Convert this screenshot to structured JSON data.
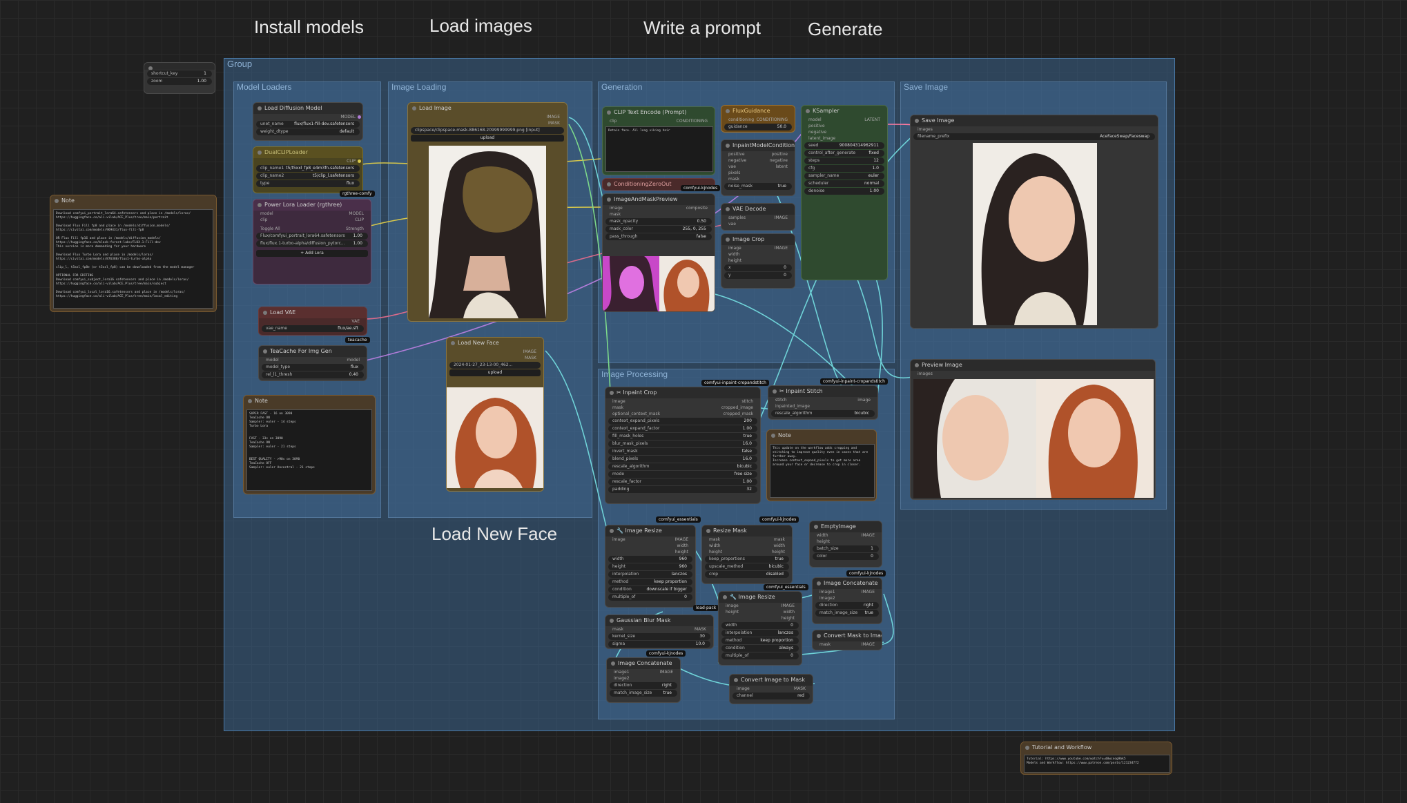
{
  "headings": {
    "install_models": "Install models",
    "load_images": "Load images",
    "write_prompt": "Write a prompt",
    "generate": "Generate",
    "load_new_face": "Load New Face"
  },
  "shortcut": {
    "key_label": "shortcut_key",
    "key_value": "1",
    "zoom_label": "zoom",
    "zoom_value": "1.00"
  },
  "group": {
    "title": "Group"
  },
  "sections": {
    "model_loaders": "Model Loaders",
    "image_loading": "Image Loading",
    "generation": "Generation",
    "save_image": "Save Image",
    "image_processing": "Image Processing"
  },
  "note_left": {
    "title": "Note",
    "text": "Download comfyui_portrait_lora64.safetensors and place in /models/loras/\nhttps://huggingface.co/ali-vilab/ACE_Plus/tree/main/portrait\n\nDownload Flux Fill fp8 and place in /models/diffusion_models/\nhttps://civitai.com/models/969431/flux-fill-fp8\n\nOR Flux Fill fp16 and place in /models/diffusion_models/\nhttps://huggingface.co/black-forest-labs/FLUX.1-Fill-dev\nThis version is more demanding for your hardware\n\nDownload Flux Turbo Lora and place in /models/loras/\nhttps://civitai.com/models/876388/flux1-turbo-alpha\n\nclip_l, t5xxl_fp8e (or t5xxl_fp8) can be downloaded from the model manager\n\nOPTIONAL FOR EDITING\nDownload comfyui_subject_lora16.safetensors and place in /models/loras/\nhttps://huggingface.co/ali-vilab/ACE_Plus/tree/main/subject\n\nDownload comfyui_local_lora16.safetensors and place in /models/loras/\nhttps://huggingface.co/ali-vilab/ACE_Plus/tree/main/local_editing"
  },
  "note_speed": {
    "title": "Note",
    "text": "SUPER FAST - 16 on 3090\nTeaCache ON\nSampler: euler - 14 steps\nTurbo Lora\n\n\nFAST - 33s on 3090\nTeaCache ON\nSampler: euler - 21 steps\n\n\nBEST QUALITY - >90s on 3090\nTeaCache OFF\nSampler: euler Ancestral - 21 steps"
  },
  "nodes": {
    "load_diffusion": {
      "title": "Load Diffusion Model",
      "out": "MODEL",
      "rows": [
        [
          "unet_name",
          "flux/flux1-fill-dev.safetensors"
        ],
        [
          "weight_dtype",
          "default"
        ]
      ]
    },
    "dual_clip": {
      "title": "DualCLIPLoader",
      "out": "CLIP",
      "rows": [
        [
          "clip_name1",
          "t5/t5xxl_fp8_e4m3fn.safetensors"
        ],
        [
          "clip_name2",
          "t5/clip_l.safetensors"
        ],
        [
          "type",
          "flux"
        ]
      ],
      "tag": "rgthree-comfy"
    },
    "power_lora": {
      "title": "Power Lora Loader (rgthree)",
      "in": [
        "model",
        "clip"
      ],
      "out": [
        "MODEL",
        "CLIP"
      ],
      "toggle_label": "Toggle All",
      "strength_label": "Strength",
      "loras": [
        [
          "Flux/comfyui_portrait_lora64.safetensors",
          "1.00"
        ],
        [
          "flux/flux.1-turbo-alpha/diffusion_pytorc...",
          "1.00"
        ]
      ],
      "add": "+ Add Lora"
    },
    "load_vae": {
      "title": "Load VAE",
      "out": "VAE",
      "rows": [
        [
          "vae_name",
          "flux/ae.sft"
        ]
      ],
      "tag": "teacache"
    },
    "teacache": {
      "title": "TeaCache For Img Gen",
      "in": "model",
      "out": "model",
      "rows": [
        [
          "model_type",
          "flux"
        ],
        [
          "rel_l1_thresh",
          "0.40"
        ]
      ]
    },
    "load_image": {
      "title": "Load Image",
      "outs": [
        "IMAGE",
        "MASK"
      ],
      "image": "clipspace/clipspace-mask-886168.20999999999.png [input]",
      "upload": "upload"
    },
    "load_new_face": {
      "title": "Load New Face",
      "outs": [
        "IMAGE",
        "MASK"
      ],
      "image": "2024-01-27_23-13-00_462...",
      "upload": "upload"
    },
    "clip_text": {
      "title": "CLIP Text Encode (Prompt)",
      "in": "clip",
      "out": "CONDITIONING",
      "prompt": "Retain face. All long viking hair"
    },
    "flux_guidance": {
      "title": "FluxGuidance",
      "in": "conditioning",
      "out": "CONDITIONING",
      "rows": [
        [
          "guidance",
          "50.0"
        ]
      ]
    },
    "cond_zero": {
      "title": "ConditioningZeroOut",
      "tag": "comfyui-kjnodes"
    },
    "inpaint_cond": {
      "title": "InpaintModelConditioning",
      "ins": [
        "positive",
        "negative",
        "vae",
        "pixels",
        "mask"
      ],
      "outs": [
        "positive",
        "negative",
        "latent"
      ],
      "rows": [
        [
          "noise_mask",
          "true"
        ]
      ]
    },
    "ksampler": {
      "title": "KSampler",
      "ins": [
        "model",
        "positive",
        "negative",
        "latent_image"
      ],
      "out": "LATENT",
      "rows": [
        [
          "seed",
          "900804314962911"
        ],
        [
          "control_after_generate",
          "fixed"
        ],
        [
          "steps",
          "12"
        ],
        [
          "cfg",
          "1.0"
        ],
        [
          "sampler_name",
          "euler"
        ],
        [
          "scheduler",
          "normal"
        ],
        [
          "denoise",
          "1.00"
        ]
      ]
    },
    "image_mask_preview": {
      "title": "ImageAndMaskPreview",
      "ins": [
        "image",
        "mask"
      ],
      "out": "composite",
      "rows": [
        [
          "mask_opacity",
          "0.50"
        ],
        [
          "mask_color",
          "255, 0, 255"
        ],
        [
          "pass_through",
          "false"
        ]
      ]
    },
    "vae_decode": {
      "title": "VAE Decode",
      "ins": [
        "samples",
        "vae"
      ],
      "out": "IMAGE"
    },
    "image_crop": {
      "title": "Image Crop",
      "in": "image",
      "out": "IMAGE",
      "rows": [
        [
          "width",
          "0"
        ],
        [
          "height",
          "0"
        ],
        [
          "x",
          "0"
        ],
        [
          "y",
          "0"
        ]
      ]
    },
    "save_image": {
      "title": "Save Image",
      "in": "images",
      "rows": [
        [
          "filename_prefix",
          "AceFaceSwap/Faceswap"
        ]
      ]
    },
    "preview_image": {
      "title": "Preview Image",
      "in": "images"
    },
    "inpaint_crop": {
      "title": "✂ Inpaint Crop",
      "tag": "comfyui-inpaint-cropandstitch",
      "ins": [
        "image",
        "mask",
        "optional_context_mask"
      ],
      "outs": [
        "stitch",
        "cropped_image",
        "cropped_mask"
      ],
      "rows": [
        [
          "context_expand_pixels",
          "200"
        ],
        [
          "context_expand_factor",
          "1.00"
        ],
        [
          "fill_mask_holes",
          "true"
        ],
        [
          "blur_mask_pixels",
          "16.0"
        ],
        [
          "invert_mask",
          "false"
        ],
        [
          "blend_pixels",
          "16.0"
        ],
        [
          "rescale_algorithm",
          "bicubic"
        ],
        [
          "mode",
          "free size"
        ],
        [
          "rescale_factor",
          "1.00"
        ],
        [
          "padding",
          "32"
        ]
      ]
    },
    "inpaint_stitch": {
      "title": "✂ Inpaint Stitch",
      "tag": "comfyui-inpaint-cropandstitch",
      "ins": [
        "stitch",
        "inpainted_image"
      ],
      "out": "image",
      "rows": [
        [
          "rescale_algorithm",
          "bicubic"
        ]
      ]
    },
    "note_mid": {
      "title": "Note",
      "text": "This update on the workflow adds cropping and\nstitching to improve quality even in cases that are\nfurther away.\nIncrease context_expand_pixels to get more area\naround your face or decrease to crop in closer."
    },
    "image_resize": {
      "title": "🔧 Image Resize",
      "tag": "comfyui_essentials",
      "in": "image",
      "outs": [
        "IMAGE",
        "width",
        "height"
      ],
      "rows": [
        [
          "width",
          "960"
        ],
        [
          "height",
          "960"
        ],
        [
          "interpolation",
          "lanczos"
        ],
        [
          "method",
          "keep proportion"
        ],
        [
          "condition",
          "downscale if bigger"
        ],
        [
          "multiple_of",
          "0"
        ]
      ]
    },
    "resize_mask": {
      "title": "Resize Mask",
      "tag": "comfyui-kjnodes",
      "ins": [
        "mask",
        "width",
        "height"
      ],
      "outs": [
        "mask",
        "width",
        "height"
      ],
      "rows": [
        [
          "keep_proportions",
          "true"
        ],
        [
          "upscale_method",
          "bicubic"
        ],
        [
          "crop",
          "disabled"
        ]
      ]
    },
    "empty_image": {
      "title": "EmptyImage",
      "ins": [
        "width",
        "height"
      ],
      "out": "IMAGE",
      "rows": [
        [
          "batch_size",
          "1"
        ],
        [
          "color",
          "0"
        ]
      ],
      "tag": "comfyui-kjnodes"
    },
    "image_resize2": {
      "title": "🔧 Image Resize",
      "tag": "comfyui_essentials",
      "ins": [
        "image",
        "height"
      ],
      "outs": [
        "IMAGE",
        "width",
        "height"
      ],
      "rows": [
        [
          "width",
          "0"
        ],
        [
          "interpolation",
          "lanczos"
        ],
        [
          "method",
          "keep proportion"
        ],
        [
          "condition",
          "always"
        ],
        [
          "multiple_of",
          "0"
        ]
      ]
    },
    "image_concat_r": {
      "title": "Image Concatenate",
      "ins": [
        "image1",
        "image2"
      ],
      "out": "IMAGE",
      "rows": [
        [
          "direction",
          "right"
        ],
        [
          "match_image_size",
          "true"
        ]
      ]
    },
    "gaussian_blur": {
      "title": "Gaussian Blur Mask",
      "in": "mask",
      "out": "MASK",
      "rows": [
        [
          "kernel_size",
          "30"
        ],
        [
          "sigma",
          "10.0"
        ]
      ],
      "tag": "comfyui-kjnodes"
    },
    "image_concat_l": {
      "title": "Image Concatenate",
      "ins": [
        "image1",
        "image2"
      ],
      "out": "IMAGE",
      "rows": [
        [
          "direction",
          "right"
        ],
        [
          "match_image_size",
          "true"
        ]
      ]
    },
    "mask_to_image": {
      "title": "Convert Mask to Image",
      "in": "mask",
      "out": "IMAGE"
    },
    "image_to_mask": {
      "title": "Convert Image to Mask",
      "in": "image",
      "out": "MASK",
      "rows": [
        [
          "channel",
          "red"
        ]
      ]
    },
    "tutorial": {
      "title": "Tutorial and Workflow",
      "text": "Tutorial: https://www.youtube.com/watch?v=d8wcnog9bk5\nModels and Workflow: https://www.patreon.com/posts/121234772"
    }
  },
  "tags": {
    "essentials_batch": "load-pack"
  },
  "colors": {
    "background": "#202020",
    "group_blue": "#3a628a",
    "node": "#353535",
    "wire_cyan": "#6fd3d8",
    "wire_yellow": "#d8c84a",
    "wire_pink": "#d86a8a"
  }
}
